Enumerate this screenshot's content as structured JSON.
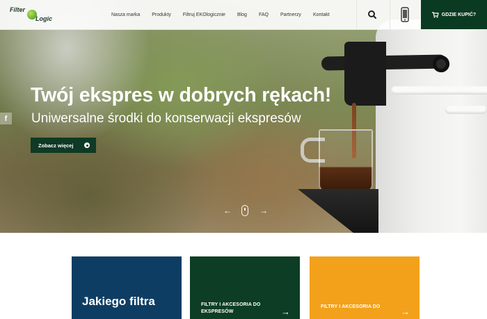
{
  "header": {
    "logo": {
      "word1": "Filter",
      "word2": "Logic"
    },
    "nav": [
      "Nasza marka",
      "Produkty",
      "Filtruj EKOlogicznie",
      "Blog",
      "FAQ",
      "Partnerzy",
      "Kontakt"
    ],
    "search_icon": "search-icon",
    "phone_icon": "mobile-phone-icon",
    "buy_label": "GDZIE KUPIĆ?",
    "buy_icon": "cart-icon"
  },
  "hero": {
    "title": "Twój ekspres w dobrych rękach!",
    "subtitle": "Uniwersalne środki do konserwacji ekspresów",
    "cta": "Zobacz więcej",
    "facebook": "f",
    "prev": "←",
    "next": "→"
  },
  "cards": [
    {
      "title": "Jakiego filtra",
      "color": "#0e3d63"
    },
    {
      "title": "FILTRY I AKCESORIA DO EKSPRESÓW",
      "arrow": "→",
      "color": "#0d3d24"
    },
    {
      "title": "FILTRY I AKCESORIA DO",
      "arrow": "→",
      "color": "#f3a11a"
    }
  ],
  "colors": {
    "brand_dark_green": "#0b3a22",
    "accent_green": "#6bbf2a"
  }
}
